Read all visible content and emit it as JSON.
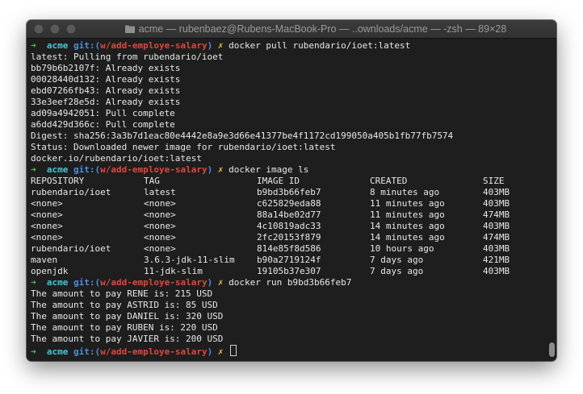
{
  "window": {
    "title": "acme — rubenbaez@Rubens-MacBook-Pro — ..ownloads/acme — -zsh — 89×28",
    "folder_icon": "folder-icon"
  },
  "prompt": {
    "arrow": "➜",
    "dir": "acme",
    "git_label": "git:(",
    "branch": "w/add-employe-salary",
    "git_close": ")",
    "dirty": "✗"
  },
  "commands": {
    "pull": "docker pull rubendario/ioet:latest",
    "images": "docker image ls",
    "run": "docker run b9bd3b66feb7"
  },
  "pull_output": [
    "latest: Pulling from rubendario/ioet",
    "bb79b6b2107f: Already exists",
    "00028440d132: Already exists",
    "ebd07266fb43: Already exists",
    "33e3eef28e5d: Already exists",
    "ad09a4942051: Pull complete",
    "a6dd429d366c: Pull complete",
    "Digest: sha256:3a3b7d1eac80e4442e8a9e3d66e41377be4f1172cd199050a405b1fb77fb7574",
    "Status: Downloaded newer image for rubendario/ioet:latest",
    "docker.io/rubendario/ioet:latest"
  ],
  "images_table": {
    "headers": [
      "REPOSITORY",
      "TAG",
      "IMAGE ID",
      "CREATED",
      "SIZE"
    ],
    "rows": [
      [
        "rubendario/ioet",
        "latest",
        "b9bd3b66feb7",
        "8 minutes ago",
        "403MB"
      ],
      [
        "<none>",
        "<none>",
        "c625829eda88",
        "11 minutes ago",
        "403MB"
      ],
      [
        "<none>",
        "<none>",
        "88a14be02d77",
        "11 minutes ago",
        "474MB"
      ],
      [
        "<none>",
        "<none>",
        "4c10819adc33",
        "14 minutes ago",
        "403MB"
      ],
      [
        "<none>",
        "<none>",
        "2fc20153f879",
        "14 minutes ago",
        "474MB"
      ],
      [
        "rubendario/ioet",
        "<none>",
        "814e85f8d586",
        "10 hours ago",
        "403MB"
      ],
      [
        "maven",
        "3.6.3-jdk-11-slim",
        "b90a2719124f",
        "7 days ago",
        "421MB"
      ],
      [
        "openjdk",
        "11-jdk-slim",
        "19105b37e307",
        "7 days ago",
        "403MB"
      ]
    ]
  },
  "run_output": [
    "The amount to pay RENE is: 215 USD",
    "The amount to pay ASTRID is: 85 USD",
    "The amount to pay DANIEL is: 320 USD",
    "The amount to pay RUBEN is: 220 USD",
    "The amount to pay JAVIER is: 200 USD"
  ],
  "colors": {
    "prompt_arrow": "#4ec94e",
    "dir": "#45c6d6",
    "git": "#4d8fe0",
    "branch": "#e0473e",
    "dirty": "#e5c34a",
    "background": "#1e1e1e"
  }
}
